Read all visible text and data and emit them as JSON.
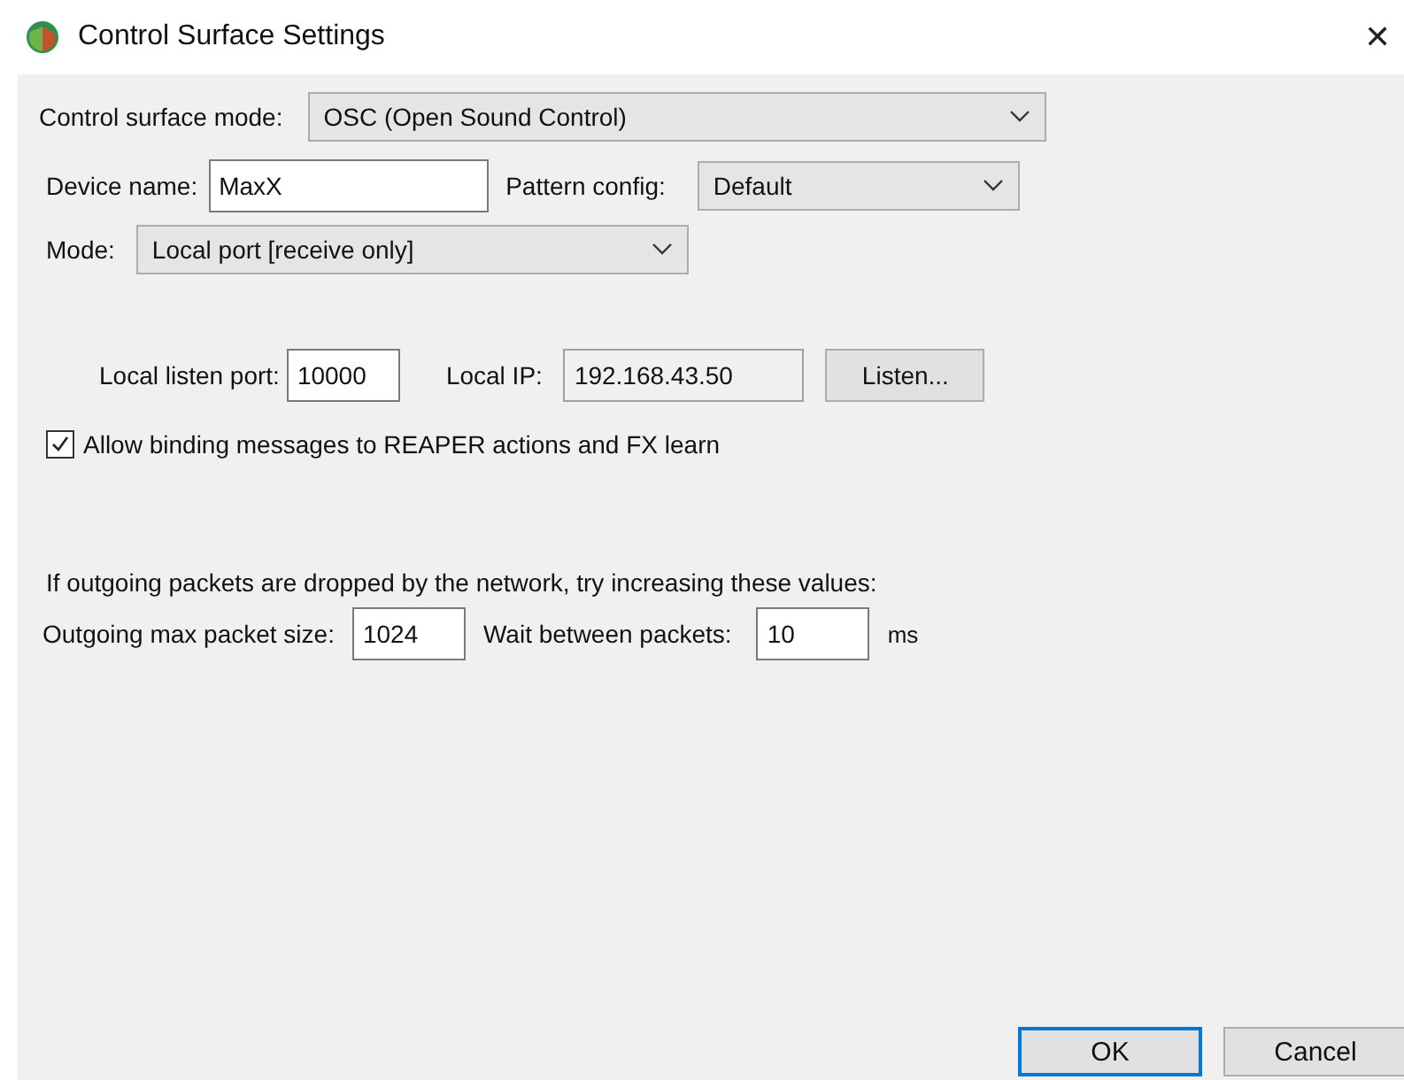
{
  "window": {
    "title": "Control Surface Settings",
    "close": "✕"
  },
  "surface_mode": {
    "label": "Control surface mode:",
    "value": "OSC (Open Sound Control)"
  },
  "device_name": {
    "label": "Device name:",
    "value": "MaxX"
  },
  "pattern_config": {
    "label": "Pattern config:",
    "value": "Default"
  },
  "mode": {
    "label": "Mode:",
    "value": "Local port [receive only]"
  },
  "listen_port": {
    "label": "Local listen port:",
    "value": "10000"
  },
  "local_ip": {
    "label": "Local IP:",
    "value": "192.168.43.50",
    "disabled": true
  },
  "listen_button": "Listen...",
  "allow_binding": {
    "label": "Allow binding messages to REAPER actions and FX learn",
    "checked": true
  },
  "packets_note": "If outgoing packets are dropped by the network, try increasing these values:",
  "max_packet": {
    "label": "Outgoing max packet size:",
    "value": "1024"
  },
  "wait": {
    "label": "Wait between packets:",
    "value": "10",
    "unit": "ms"
  },
  "buttons": [
    {
      "label": "OK",
      "selected": true
    },
    {
      "label": "Cancel",
      "selected": false
    }
  ]
}
